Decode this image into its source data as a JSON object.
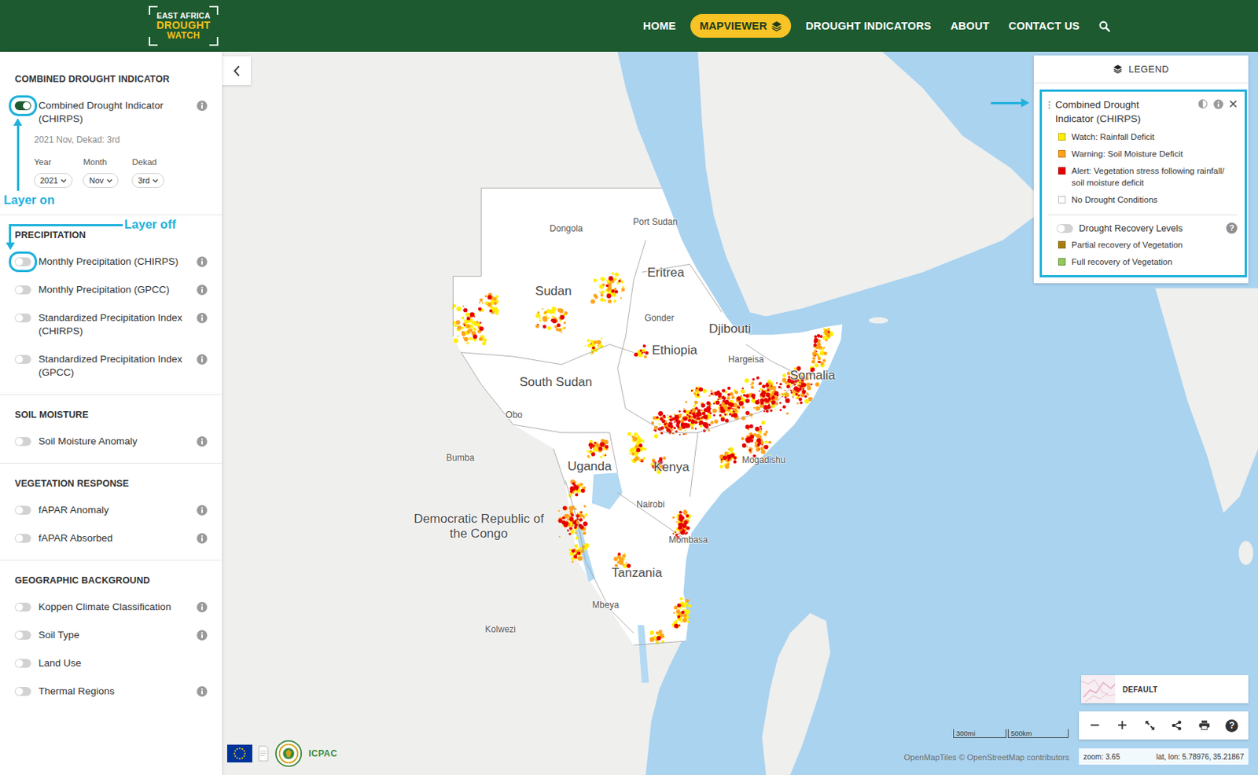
{
  "header": {
    "logo": {
      "top": "EAST AFRICA",
      "middle": "DROUGHT",
      "bottom": "WATCH"
    },
    "nav": [
      {
        "label": "HOME",
        "selected": false
      },
      {
        "label": "MAPVIEWER",
        "selected": true
      },
      {
        "label": "DROUGHT INDICATORS",
        "selected": false
      },
      {
        "label": "ABOUT",
        "selected": false
      },
      {
        "label": "CONTACT US",
        "selected": false
      }
    ]
  },
  "sidebar": {
    "sections": [
      {
        "title": "COMBINED DROUGHT INDICATOR",
        "layers": [
          {
            "label": "Combined Drought Indicator (CHIRPS)",
            "on": true,
            "info": true,
            "outlined": true,
            "date": "2021 Nov, Dekad: 3rd",
            "selectors": [
              {
                "label": "Year",
                "value": "2021"
              },
              {
                "label": "Month",
                "value": "Nov"
              },
              {
                "label": "Dekad",
                "value": "3rd"
              }
            ],
            "annotation": {
              "text": "Layer on",
              "kind": "up"
            }
          }
        ]
      },
      {
        "title": "PRECIPITATION",
        "layers": [
          {
            "label": "Monthly Precipitation (CHIRPS)",
            "on": false,
            "info": true,
            "outlined": true,
            "annotation": {
              "text": "Layer off",
              "kind": "down"
            }
          },
          {
            "label": "Monthly Precipitation (GPCC)",
            "on": false,
            "info": true,
            "outlined": false
          },
          {
            "label": "Standardized Precipitation Index (CHIRPS)",
            "on": false,
            "info": true,
            "outlined": false
          },
          {
            "label": "Standardized Precipitation Index (GPCC)",
            "on": false,
            "info": true,
            "outlined": false
          }
        ]
      },
      {
        "title": "SOIL MOISTURE",
        "layers": [
          {
            "label": "Soil Moisture Anomaly",
            "on": false,
            "info": true,
            "outlined": false
          }
        ]
      },
      {
        "title": "VEGETATION RESPONSE",
        "layers": [
          {
            "label": "fAPAR Anomaly",
            "on": false,
            "info": true,
            "outlined": false
          },
          {
            "label": "fAPAR Absorbed",
            "on": false,
            "info": true,
            "outlined": false
          }
        ]
      },
      {
        "title": "GEOGRAPHIC BACKGROUND",
        "layers": [
          {
            "label": "Koppen Climate Classification",
            "on": false,
            "info": true,
            "outlined": false
          },
          {
            "label": "Soil Type",
            "on": false,
            "info": true,
            "outlined": false
          },
          {
            "label": "Land Use",
            "on": false,
            "info": false,
            "outlined": false
          },
          {
            "label": "Thermal Regions",
            "on": false,
            "info": true,
            "outlined": false
          }
        ]
      }
    ]
  },
  "map": {
    "labels": [
      {
        "text": "Dongola",
        "kind": "city"
      },
      {
        "text": "Port Sudan",
        "kind": "city"
      },
      {
        "text": "Sudan",
        "kind": "country"
      },
      {
        "text": "Eritrea",
        "kind": "country"
      },
      {
        "text": "Gonder",
        "kind": "city"
      },
      {
        "text": "Djibouti",
        "kind": "country"
      },
      {
        "text": "Ethiopia",
        "kind": "country"
      },
      {
        "text": "Hargeisa",
        "kind": "city"
      },
      {
        "text": "Somalia",
        "kind": "country"
      },
      {
        "text": "South Sudan",
        "kind": "country"
      },
      {
        "text": "Obo",
        "kind": "city"
      },
      {
        "text": "Bumba",
        "kind": "city"
      },
      {
        "text": "Uganda",
        "kind": "country"
      },
      {
        "text": "Kenya",
        "kind": "country"
      },
      {
        "text": "Mogadishu",
        "kind": "city"
      },
      {
        "text": "Nairobi",
        "kind": "city"
      },
      {
        "text": "Democratic Republic of the Congo",
        "kind": "country"
      },
      {
        "text": "Mombasa",
        "kind": "city"
      },
      {
        "text": "Tanzania",
        "kind": "country"
      },
      {
        "text": "Mbeya",
        "kind": "city"
      },
      {
        "text": "Kolwezi",
        "kind": "city"
      }
    ],
    "scale": {
      "imperial": "300mi",
      "metric": "500km"
    },
    "attribution": "OpenMapTiles  © OpenStreetMap contributors",
    "status": {
      "zoom": "zoom: 3.65",
      "position": "lat, lon: 5.78976, 35.21867"
    },
    "basemap": {
      "label": "DEFAULT"
    },
    "partners": {
      "icpac": "ICPAC"
    },
    "toolbar": [
      {
        "kind": "minus"
      },
      {
        "kind": "plus"
      },
      {
        "kind": "fullscreen"
      },
      {
        "kind": "share"
      },
      {
        "kind": "print"
      },
      {
        "kind": "help",
        "text": "?"
      }
    ]
  },
  "legend": {
    "title": "LEGEND",
    "panel": {
      "title": "Combined Drought Indicator (CHIRPS)",
      "outlined": true,
      "items": [
        {
          "label": "Watch: Rainfall Deficit",
          "color": "#ffee00"
        },
        {
          "label": "Warning: Soil Moisture Deficit",
          "color": "#ffa31a"
        },
        {
          "label": "Alert: Vegetation stress following rainfall/ soil moisture deficit",
          "color": "#e60000"
        },
        {
          "label": "No Drought Conditions",
          "color": "#ffffff"
        }
      ],
      "recovery": {
        "label": "Drought Recovery Levels",
        "on": false,
        "help": "?",
        "items": [
          {
            "label": "Partial recovery of Vegetation",
            "color": "#a67f08"
          },
          {
            "label": "Full recovery of Vegetation",
            "color": "#93c85c"
          }
        ]
      }
    }
  }
}
